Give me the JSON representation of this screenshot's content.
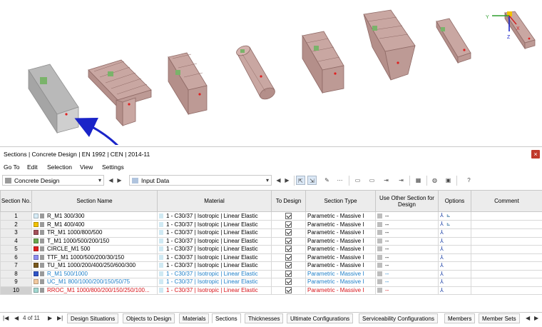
{
  "window": {
    "title": "Sections | Concrete Design | EN 1992 | CEN | 2014-11",
    "close_label": "×"
  },
  "menu": [
    "Go To",
    "Edit",
    "Selection",
    "View",
    "Settings"
  ],
  "toolbar": {
    "module_combo": "Concrete Design",
    "input_combo": "Input Data"
  },
  "table": {
    "headers": {
      "no": "Section No.",
      "name": "Section Name",
      "material": "Material",
      "to_design": "To Design",
      "type": "Section Type",
      "other": "Use Other Section for Design",
      "options": "Options",
      "comment": "Comment"
    },
    "rows": [
      {
        "no": "1",
        "color": "#d7ecf7",
        "name": "R_M1 300/300",
        "material": "1 - C30/37 | Isotropic | Linear Elastic",
        "type": "Parametric - Massive I",
        "other": "--",
        "style": "normal"
      },
      {
        "no": "2",
        "color": "#f2c200",
        "name": "R_M1 400/400",
        "material": "1 - C30/37 | Isotropic | Linear Elastic",
        "type": "Parametric - Massive I",
        "other": "--",
        "style": "normal"
      },
      {
        "no": "3",
        "color": "#a4505a",
        "name": "TR_M1 1000/800/500",
        "material": "1 - C30/37 | Isotropic | Linear Elastic",
        "type": "Parametric - Massive I",
        "other": "--",
        "style": "normal"
      },
      {
        "no": "4",
        "color": "#6aa84f",
        "name": "T_M1 1000/500/200/150",
        "material": "1 - C30/37 | Isotropic | Linear Elastic",
        "type": "Parametric - Massive I",
        "other": "--",
        "style": "normal"
      },
      {
        "no": "5",
        "color": "#e02020",
        "name": "CIRCLE_M1 500",
        "material": "1 - C30/37 | Isotropic | Linear Elastic",
        "type": "Parametric - Massive I",
        "other": "--",
        "style": "normal"
      },
      {
        "no": "6",
        "color": "#8e8ef0",
        "name": "TTF_M1 1000/500/200/30/150",
        "material": "1 - C30/37 | Isotropic | Linear Elastic",
        "type": "Parametric - Massive I",
        "other": "--",
        "style": "normal"
      },
      {
        "no": "7",
        "color": "#7a5a1e",
        "name": "TU_M1 1000/200/400/250/600/300",
        "material": "1 - C30/37 | Isotropic | Linear Elastic",
        "type": "Parametric - Massive I",
        "other": "--",
        "style": "normal"
      },
      {
        "no": "8",
        "color": "#2f55c8",
        "name": "R_M1 500/1000",
        "material": "1 - C30/37 | Isotropic | Linear Elastic",
        "type": "Parametric - Massive I",
        "other": "--",
        "style": "blue"
      },
      {
        "no": "9",
        "color": "#f2c9a0",
        "name": "UC_M1 800/1000/200/150/50/75",
        "material": "1 - C30/37 | Isotropic | Linear Elastic",
        "type": "Parametric - Massive I",
        "other": "--",
        "style": "blue"
      },
      {
        "no": "10",
        "color": "#a3d9d2",
        "name": "RROC_M1 1000/800/200/150/250/100...",
        "material": "1 - C30/37 | Isotropic | Linear Elastic",
        "type": "Parametric - Massive I",
        "other": "--",
        "style": "red"
      }
    ]
  },
  "pager": "4 of 11",
  "tabs": [
    "Design Situations",
    "Objects to Design",
    "Materials",
    "Sections",
    "Thicknesses",
    "Ultimate Configurations",
    "Serviceability Configurations",
    "Members",
    "Member Sets"
  ],
  "active_tab": "Sections",
  "axes": {
    "x": "X",
    "y": "Y",
    "z": "Z"
  },
  "colors": {
    "arrow": "#1a24c8",
    "section_fill": "#c9a7a2",
    "rebar_green": "#7ab36a",
    "red_dot": "#e02020"
  }
}
